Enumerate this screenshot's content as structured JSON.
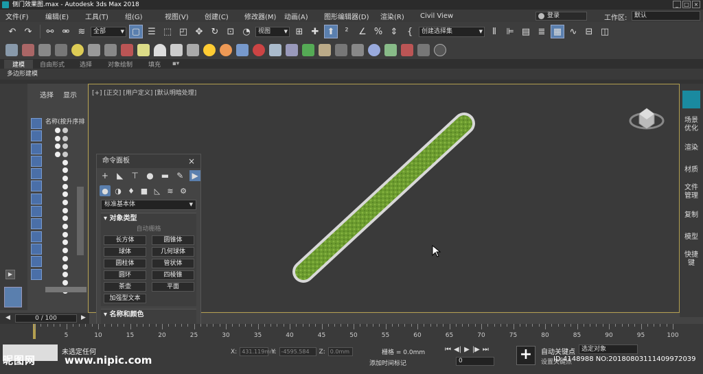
{
  "window": {
    "title": "侧门效果图.max - Autodesk 3ds Max 2018",
    "controls": [
      "_",
      "□",
      "×"
    ]
  },
  "menubar": {
    "items": [
      "文件(F)",
      "编辑(E)",
      "工具(T)",
      "组(G)",
      "视图(V)",
      "创建(C)",
      "修改器(M)",
      "动画(A)",
      "图形编辑器(D)",
      "渲染(R)",
      "Civil View"
    ],
    "login": "登录",
    "workspace_label": "工作区:",
    "workspace_value": "默认"
  },
  "toolbar": {
    "filter_value": "全部",
    "refcoord_value": "视图",
    "selection_set_value": "创建选择集"
  },
  "ribbon": {
    "tabs": [
      "建模",
      "自由形式",
      "选择",
      "对象绘制",
      "填充"
    ],
    "active_tab": "建模",
    "panel_label": "多边形建模"
  },
  "explorer": {
    "tabs": [
      "选择",
      "显示"
    ],
    "column_title": "名称(按升序排"
  },
  "viewport": {
    "label": "[+] [正交] [用户定义] [默认明暗处理]"
  },
  "command_panel": {
    "title": "命令面板",
    "close": "×",
    "type_dropdown": "标准基本体",
    "object_type_header": "对象类型",
    "autogrid": "自动栅格",
    "buttons": [
      "长方体",
      "圆锥体",
      "球体",
      "几何球体",
      "圆柱体",
      "管状体",
      "圆环",
      "四棱锥",
      "茶壶",
      "平面",
      "加强型文本"
    ],
    "name_color_header": "名称和颜色",
    "color": "#c8306a"
  },
  "right_panel": {
    "items": [
      "场景\n优化",
      "渲染",
      "材质",
      "文件\n管理",
      "复制",
      "模型",
      "快捷\n键"
    ]
  },
  "timeline": {
    "slider_value": "0 / 100",
    "ticks": [
      5,
      10,
      15,
      20,
      25,
      30,
      35,
      40,
      45,
      50,
      55,
      60,
      65,
      70,
      75,
      80,
      85,
      90,
      95,
      100
    ]
  },
  "status": {
    "message": "未选定任何",
    "x_label": "X:",
    "x_value": "431.119mm",
    "y_label": "Y:",
    "y_value": "-4595.584",
    "z_label": "Z:",
    "z_value": "0.0mm",
    "grid": "栅格 = 0.0mm",
    "add_time_tag": "添加时间标记",
    "frame_value": "0",
    "autokey": "自动关键点",
    "selected_object": "选定对象",
    "setkey": "设置关键点",
    "ime": "英"
  },
  "watermark": {
    "logo": "昵图网",
    "url": "www.nipic.com",
    "id": "ID:4148988 NO:20180803111409972039"
  }
}
